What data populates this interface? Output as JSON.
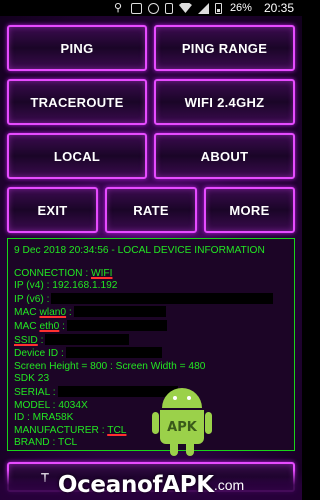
{
  "statusbar": {
    "battery_pct": "26%",
    "time": "20:35"
  },
  "buttons": {
    "ping": "PING",
    "ping_range": "PING RANGE",
    "traceroute": "TRACEROUTE",
    "wifi": "WIFI 2.4GHZ",
    "local": "LOCAL",
    "about": "ABOUT",
    "exit": "EXIT",
    "rate": "RATE",
    "more": "MORE",
    "bottom": "T"
  },
  "info": {
    "header": "9 Dec 2018 20:34:56 - LOCAL DEVICE INFORMATION",
    "connection_label": "CONNECTION : ",
    "connection_value": "WIFI",
    "ipv4": "IP (v4) : 192.168.1.192",
    "ipv6": "IP (v6) :",
    "mac_wlan0_label": "MAC ",
    "mac_wlan0_iface": "wlan0",
    "mac_wlan0_sep": " :",
    "mac_eth0_label": "MAC ",
    "mac_eth0_iface": "eth0",
    "mac_eth0_sep": " :",
    "ssid_label": "SSID",
    "ssid_sep": " :",
    "device_id": "Device ID :",
    "screen": "Screen Height = 800 : Screen Width = 480",
    "sdk": "SDK  23",
    "serial": "SERIAL :",
    "model": "MODEL : 4034X",
    "id": "ID : MRA58K",
    "manufacturer_label": "MANUFACTURER : ",
    "manufacturer_value": "TCL",
    "brand_label": "BRAND : ",
    "brand_value": "TCL"
  },
  "logo": {
    "badge_text": "APK"
  },
  "watermark": {
    "text": "OceanofAPK",
    "suffix": ".com"
  },
  "colors": {
    "accent": "#e64bff",
    "text_green": "#22e622",
    "border_green": "#19d419",
    "underline_red": "#ff3030"
  }
}
